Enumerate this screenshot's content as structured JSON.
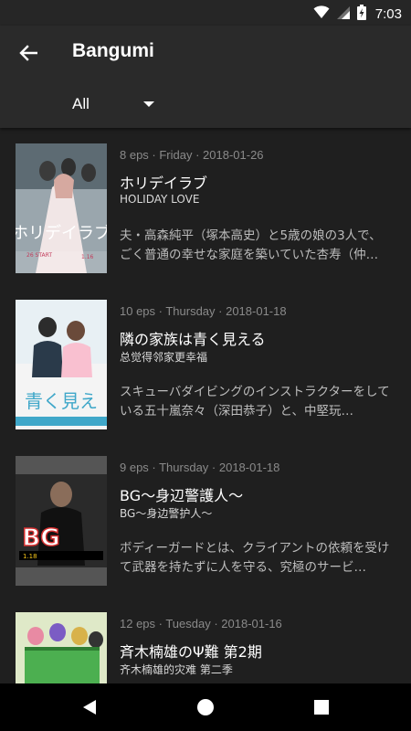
{
  "status_bar": {
    "time": "7:03",
    "icons": [
      "wifi-icon",
      "signal-icon",
      "battery-charging-icon"
    ]
  },
  "app_bar": {
    "title": "Bangumi",
    "back_icon": "arrow-back-icon",
    "filter": {
      "selected": "All"
    }
  },
  "items": [
    {
      "meta": "8 eps · Friday · 2018-01-26",
      "title": "ホリデイラブ",
      "subtitle": "HOLIDAY LOVE",
      "description": "夫・高森純平（塚本高史）と5歳の娘の3人で、ごく普通の幸せな家庭を築いていた杏寿（仲…",
      "cover_text": "ホリデイラブ",
      "cover_accent": "#c23b5a"
    },
    {
      "meta": "10 eps · Thursday · 2018-01-18",
      "title": "隣の家族は青く見える",
      "subtitle": "总觉得邻家更幸福",
      "description": "スキューバダイビングのインストラクターをしている五十嵐奈々（深田恭子）と、中堅玩…",
      "cover_text": "青く見え",
      "cover_accent": "#3fa7c9"
    },
    {
      "meta": "9 eps · Thursday · 2018-01-18",
      "title": "BG～身辺警護人～",
      "subtitle": "BG～身边警护人～",
      "description": "ボディーガードとは、クライアントの依頼を受けて武器を持たずに人を守る、究極のサービ…",
      "cover_text": "BG",
      "cover_accent": "#d32f2f"
    },
    {
      "meta": "12 eps · Tuesday · 2018-01-16",
      "title": "斉木楠雄のΨ難 第2期",
      "subtitle": "齐木楠雄的灾难 第二季",
      "description": "",
      "cover_text": "",
      "cover_accent": "#4caf50"
    }
  ],
  "nav_bar": {
    "icons": [
      "back-triangle-icon",
      "home-circle-icon",
      "recents-square-icon"
    ]
  }
}
